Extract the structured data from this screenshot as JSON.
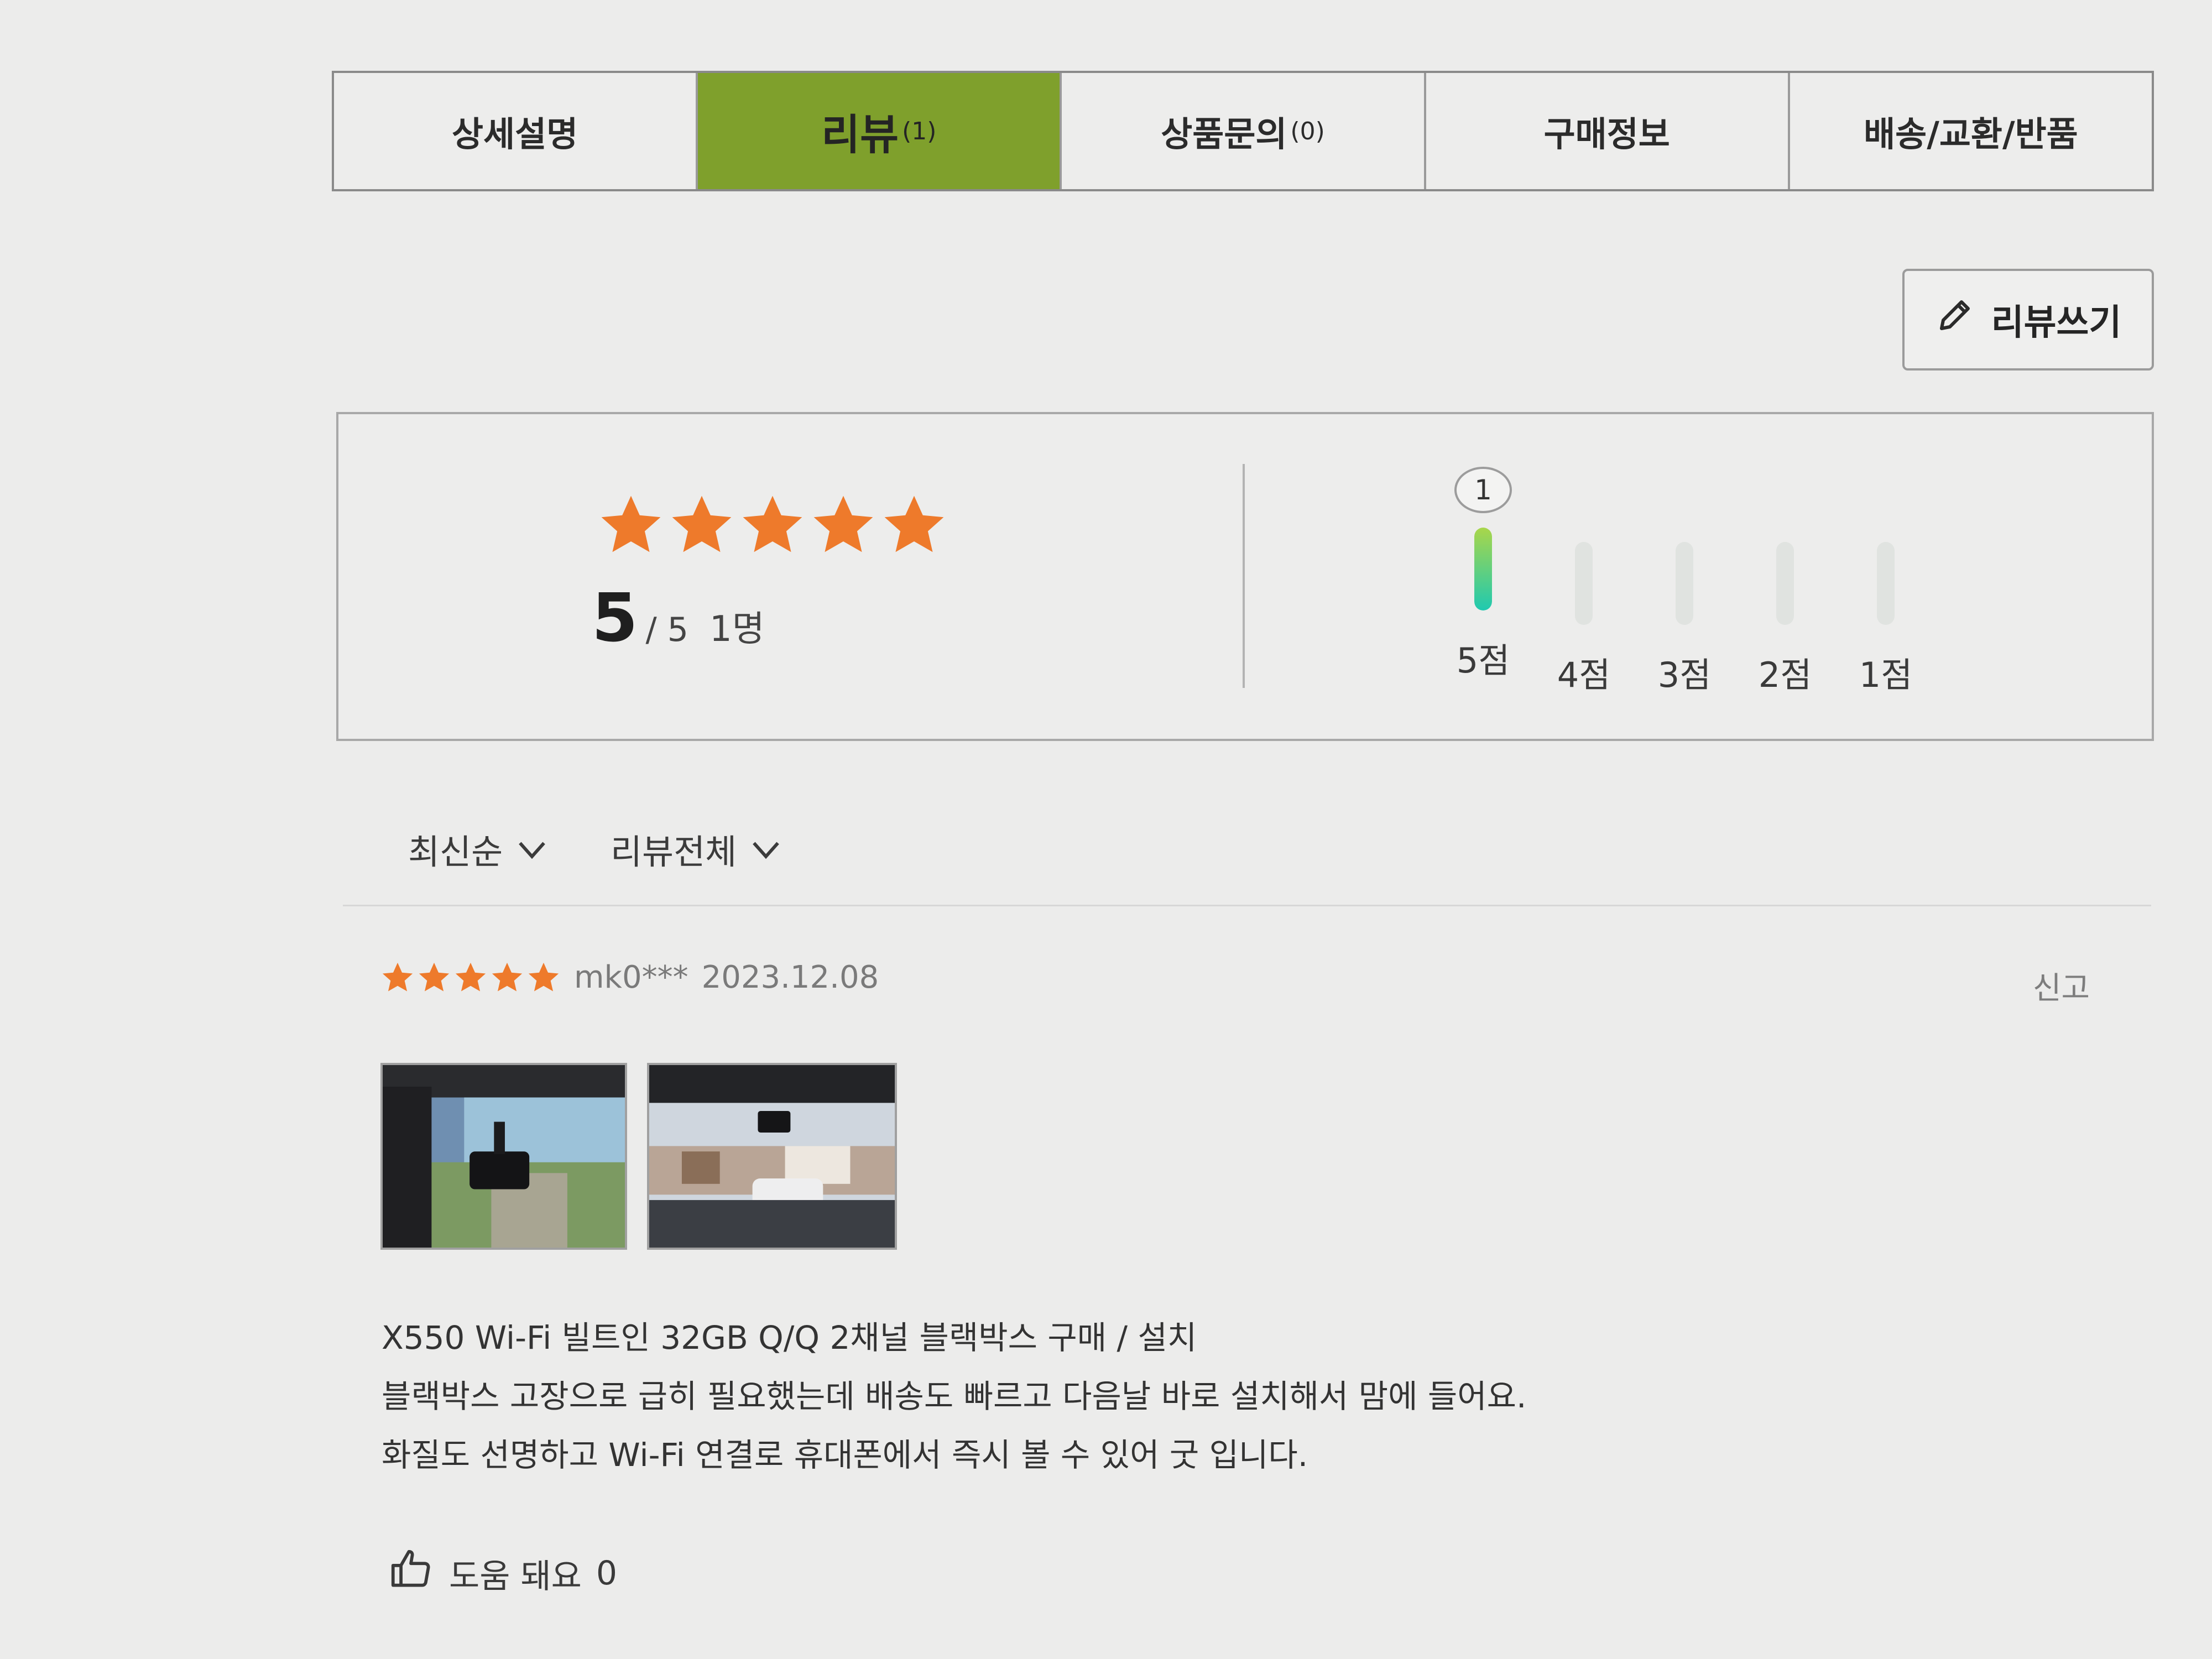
{
  "tabs": [
    {
      "label": "상세설명",
      "count": ""
    },
    {
      "label": "리뷰",
      "count": "(1)",
      "active": true
    },
    {
      "label": "상품문의",
      "count": "(0)"
    },
    {
      "label": "구매정보",
      "count": ""
    },
    {
      "label": "배송/교환/반품",
      "count": ""
    }
  ],
  "write_review_label": "리뷰쓰기",
  "summary": {
    "score": "5",
    "out_of": "/ 5",
    "reviewers": "1명",
    "distribution": [
      {
        "label": "5점",
        "count": "1",
        "fraction": 1.0
      },
      {
        "label": "4점",
        "count": "",
        "fraction": 0
      },
      {
        "label": "3점",
        "count": "",
        "fraction": 0
      },
      {
        "label": "2점",
        "count": "",
        "fraction": 0
      },
      {
        "label": "1점",
        "count": "",
        "fraction": 0
      }
    ]
  },
  "filters": {
    "sort": "최신순",
    "scope": "리뷰전체"
  },
  "review": {
    "user": "mk0***",
    "date": "2023.12.08",
    "report": "신고",
    "lines": [
      "X550 Wi-Fi 빌트인 32GB Q/Q 2채널 블랙박스 구매 / 설치",
      "블랙박스 고장으로 급히 필요했는데 배송도 빠르고 다음날 바로 설치해서 맘에 들어요.",
      "화질도 선명하고 Wi-Fi 연결로 휴대폰에서 즉시 볼 수 있어 굿 입니다."
    ],
    "helpful_label": "도움 돼요",
    "helpful_count": "0"
  },
  "colors": {
    "accent_tab": "#7fa02c",
    "star": "#ee7a2b",
    "bar": "#1fc9b0"
  }
}
